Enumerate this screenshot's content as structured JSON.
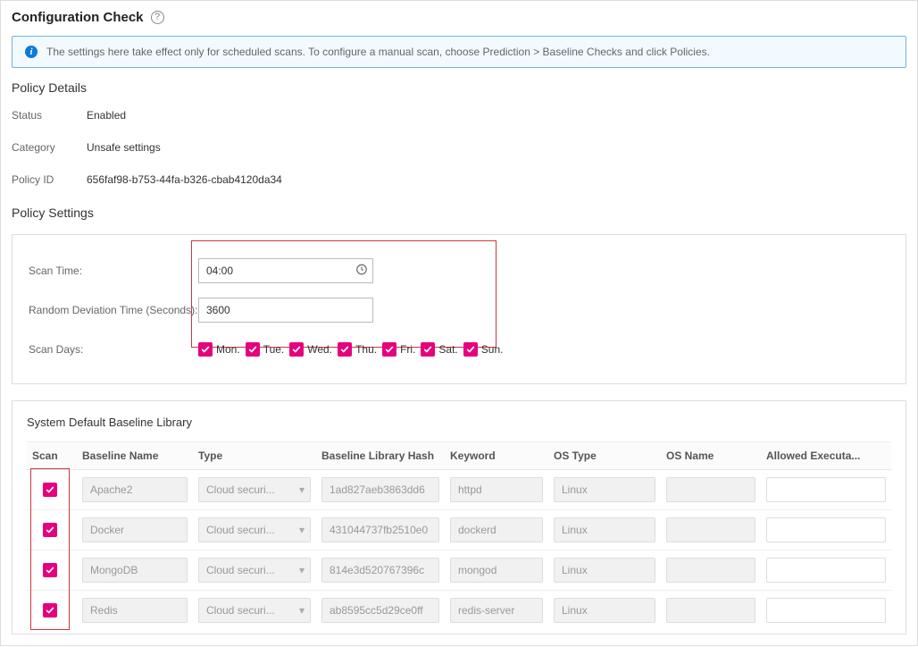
{
  "header": {
    "title": "Configuration Check"
  },
  "banner": {
    "text": "The settings here take effect only for scheduled scans. To configure a manual scan, choose Prediction > Baseline Checks and click Policies."
  },
  "policy_details": {
    "heading": "Policy Details",
    "status_label": "Status",
    "status_value": "Enabled",
    "category_label": "Category",
    "category_value": "Unsafe settings",
    "policy_id_label": "Policy ID",
    "policy_id_value": "656faf98-b753-44fa-b326-cbab4120da34"
  },
  "policy_settings": {
    "heading": "Policy Settings",
    "scan_time_label": "Scan Time:",
    "scan_time_value": "04:00",
    "deviation_label": "Random Deviation Time (Seconds):",
    "deviation_value": "3600",
    "scan_days_label": "Scan Days:",
    "days": [
      "Mon.",
      "Tue.",
      "Wed.",
      "Thu.",
      "Fri.",
      "Sat.",
      "Sun."
    ]
  },
  "library": {
    "heading": "System Default Baseline Library",
    "columns": {
      "scan": "Scan",
      "name": "Baseline Name",
      "type": "Type",
      "hash": "Baseline Library Hash",
      "keyword": "Keyword",
      "ostype": "OS Type",
      "osname": "OS Name",
      "exec": "Allowed Executa..."
    },
    "type_display": "Cloud securi...",
    "rows": [
      {
        "name": "Apache2",
        "hash": "1ad827aeb3863dd6",
        "keyword": "httpd",
        "ostype": "Linux"
      },
      {
        "name": "Docker",
        "hash": "431044737fb2510e0",
        "keyword": "dockerd",
        "ostype": "Linux"
      },
      {
        "name": "MongoDB",
        "hash": "814e3d520767396c",
        "keyword": "mongod",
        "ostype": "Linux"
      },
      {
        "name": "Redis",
        "hash": "ab8595cc5d29ce0ff",
        "keyword": "redis-server",
        "ostype": "Linux"
      }
    ]
  }
}
